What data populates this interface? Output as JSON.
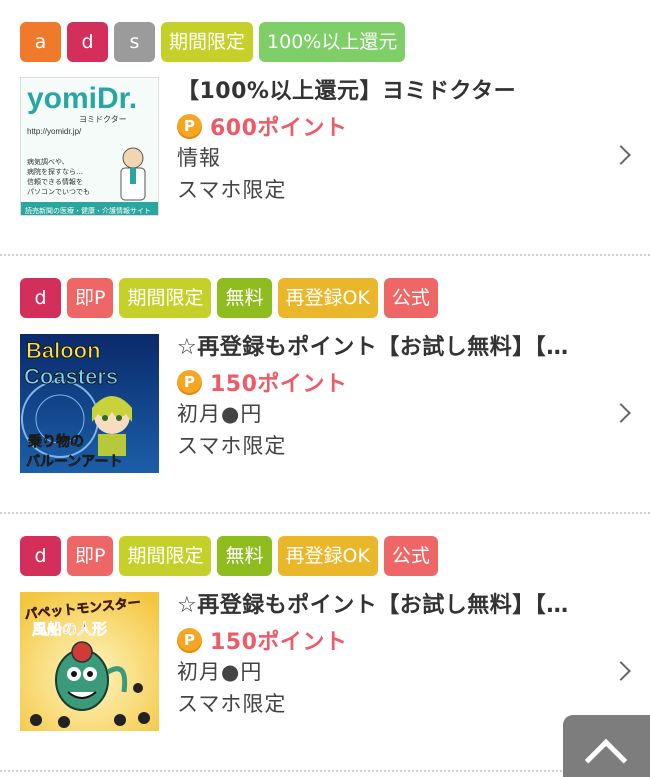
{
  "items": [
    {
      "tags": [
        {
          "label": "a",
          "color": "#f07a2b"
        },
        {
          "label": "d",
          "color": "#d42e5a"
        },
        {
          "label": "s",
          "color": "#9b9b9b"
        },
        {
          "label": "期間限定",
          "color": "#c5d12a"
        },
        {
          "label": "100%以上還元",
          "color": "#7fcf68"
        }
      ],
      "title": "【100%以上還元】ヨミドクター",
      "coin_symbol": "P",
      "points": "600ポイント",
      "line1": "情報",
      "line2": "スマホ限定",
      "thumb": {
        "name": "yomidr-thumbnail",
        "brand": "yomiDr.",
        "sub": "ヨミドクター",
        "url": "http://yomidr.jp/",
        "desc1": "病気調べや、",
        "desc2": "病院を探すなら…",
        "desc3": "信頼できる情報を",
        "desc4": "パソコンでいつでも",
        "footer": "読売新聞の医療・健康・介護情報サイト"
      }
    },
    {
      "tags": [
        {
          "label": "d",
          "color": "#d42e5a"
        },
        {
          "label": "即P",
          "color": "#ee6666"
        },
        {
          "label": "期間限定",
          "color": "#c5d12a"
        },
        {
          "label": "無料",
          "color": "#8fbc1f"
        },
        {
          "label": "再登録OK",
          "color": "#eab62a"
        },
        {
          "label": "公式",
          "color": "#ee6666"
        }
      ],
      "title": "☆再登録もポイント【お試し無料】【…",
      "coin_symbol": "P",
      "points": "150ポイント",
      "line1": "初月●円",
      "line2": "スマホ限定",
      "thumb": {
        "name": "baloon-coasters-thumbnail",
        "t1": "Baloon",
        "t2": "Coasters",
        "t3": "乗り物の",
        "t4": "バルーンアート"
      }
    },
    {
      "tags": [
        {
          "label": "d",
          "color": "#d42e5a"
        },
        {
          "label": "即P",
          "color": "#ee6666"
        },
        {
          "label": "期間限定",
          "color": "#c5d12a"
        },
        {
          "label": "無料",
          "color": "#8fbc1f"
        },
        {
          "label": "再登録OK",
          "color": "#eab62a"
        },
        {
          "label": "公式",
          "color": "#ee6666"
        }
      ],
      "title": "☆再登録もポイント【お試し無料】【…",
      "coin_symbol": "P",
      "points": "150ポイント",
      "line1": "初月●円",
      "line2": "スマホ限定",
      "thumb": {
        "name": "puppet-monster-thumbnail",
        "t1": "パペットモンスター",
        "t2": "風船の人形"
      }
    }
  ],
  "go_top_icon": "chevron-up-icon"
}
